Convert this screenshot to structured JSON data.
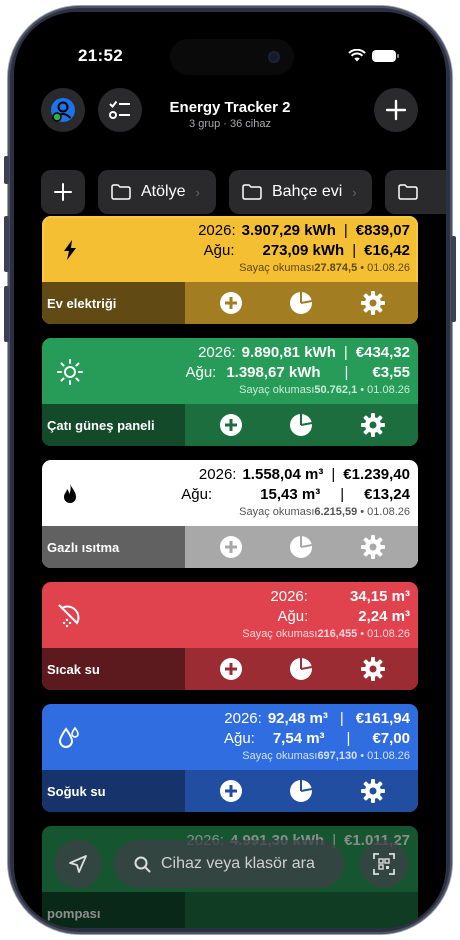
{
  "status": {
    "time": "21:52"
  },
  "header": {
    "title": "Energy Tracker 2",
    "subtitle": "3 grup · 36 cihaz"
  },
  "folders": [
    {
      "label": "Atölye"
    },
    {
      "label": "Bahçe evi"
    }
  ],
  "devices": [
    {
      "name": "Ev elektriği",
      "year_label": "2026:",
      "year_usage": "3.907,29 kWh",
      "year_cost": "€839,07",
      "net_label": "Ağu:",
      "net_usage": "273,09 kWh",
      "net_cost": "€16,42",
      "meter_label": "Sayaç okuması",
      "meter_value": "27.874,5",
      "meter_date": " • 01.08.26",
      "color": "#f4bf33",
      "icon": "bolt-icon"
    },
    {
      "name": "Çatı güneş paneli",
      "year_label": "2026:",
      "year_usage": "9.890,81 kWh",
      "year_cost": "€434,32",
      "net_label": "Ağu:",
      "net_usage": "1.398,67 kWh",
      "net_cost": "€3,55",
      "meter_label": "Sayaç okuması",
      "meter_value": "50.762,1",
      "meter_date": " • 01.08.26",
      "color": "#279c58",
      "icon": "sun-icon"
    },
    {
      "name": "Gazlı ısıtma",
      "year_label": "2026:",
      "year_usage": "1.558,04 m³",
      "year_cost": "€1.239,40",
      "net_label": "Ağu:",
      "net_usage": "15,43 m³",
      "net_cost": "€13,24",
      "meter_label": "Sayaç okuması",
      "meter_value": "6.215,59",
      "meter_date": " • 01.08.26",
      "color": "#ffffff",
      "icon": "flame-icon"
    },
    {
      "name": "Sıcak su",
      "year_label": "2026:",
      "year_usage": "34,15 m³",
      "net_label": "Ağu:",
      "net_usage": "2,24 m³",
      "meter_label": "Sayaç okuması",
      "meter_value": "216,455",
      "meter_date": " • 01.08.26",
      "color": "#e0434d",
      "icon": "shower-icon"
    },
    {
      "name": "Soğuk su",
      "year_label": "2026:",
      "year_usage": "92,48 m³",
      "year_cost": "€161,94",
      "net_label": "Ağu:",
      "net_usage": "7,54 m³",
      "net_cost": "€7,00",
      "meter_label": "Sayaç okuması",
      "meter_value": "697,130",
      "meter_date": " • 01.08.26",
      "color": "#2f6de0",
      "icon": "drops-icon"
    },
    {
      "name": "pompası",
      "year_label": "2026:",
      "year_usage": "4.991,30 kWh",
      "year_cost": "€1.011,27",
      "color": "#279c58"
    }
  ],
  "search": {
    "placeholder": "Cihaz veya klasör ara"
  }
}
